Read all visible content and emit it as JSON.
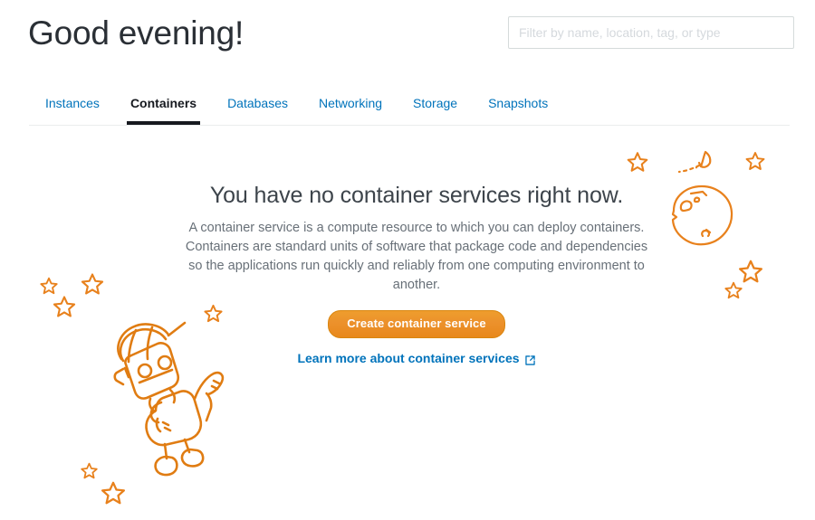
{
  "header": {
    "greeting": "Good evening!",
    "filter_placeholder": "Filter by name, location, tag, or type",
    "filter_value": ""
  },
  "tabs": [
    {
      "label": "Instances",
      "active": false
    },
    {
      "label": "Containers",
      "active": true
    },
    {
      "label": "Databases",
      "active": false
    },
    {
      "label": "Networking",
      "active": false
    },
    {
      "label": "Storage",
      "active": false
    },
    {
      "label": "Snapshots",
      "active": false
    }
  ],
  "empty_state": {
    "title": "You have no container services right now.",
    "description": "A container service is a compute resource to which you can deploy containers. Containers are standard units of software that package code and dependencies so the applications run quickly and reliably from one computing environment to another.",
    "primary_button": "Create container service",
    "learn_more_link": "Learn more about container services",
    "external_icon": "external-link-icon"
  },
  "illustration": {
    "robot": "robot-astronaut-doodle",
    "planet": "planet-doodle",
    "rocket": "rocket-with-trail-doodle",
    "stars": "star-doodles"
  },
  "colors": {
    "accent_orange": "#e8881b",
    "link_blue": "#0073bb",
    "active_tab": "#16191f",
    "text_muted": "#687078",
    "border": "#d5dbdb"
  }
}
